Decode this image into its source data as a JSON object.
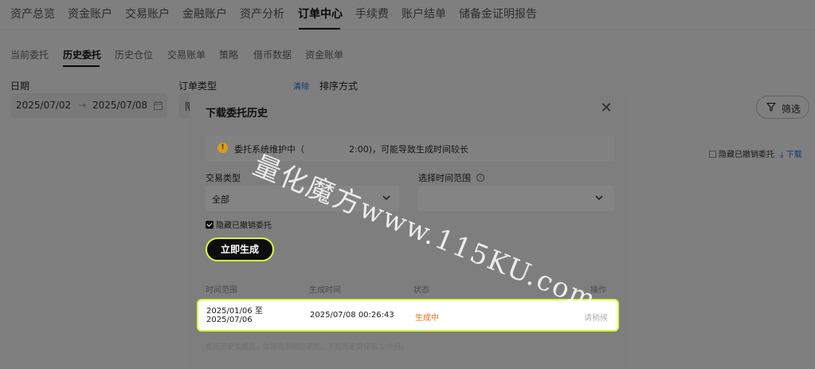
{
  "top_nav": {
    "items": [
      "资产总览",
      "资金账户",
      "交易账户",
      "金融账户",
      "资产分析",
      "订单中心",
      "手续费",
      "账户结单",
      "储备金证明报告"
    ],
    "active_index": 5
  },
  "sub_nav": {
    "items": [
      "当前委托",
      "历史委托",
      "历史仓位",
      "交易账单",
      "策略",
      "借币数据",
      "资金账单"
    ],
    "active_index": 1
  },
  "filters": {
    "date_label": "日期",
    "date_start": "2025/07/02",
    "date_arrow": "→",
    "date_end": "2025/07/08",
    "order_type_label": "订单类型",
    "order_type_value": "限",
    "clear_label": "清除",
    "sort_label": "排序方式",
    "filter_button": "筛选"
  },
  "right_controls": {
    "hide_cancelled": "隐藏已撤销委托",
    "download": "下载"
  },
  "modal": {
    "title": "下载委托历史",
    "close_symbol": "✕",
    "notice": "委托系统维护中（",
    "notice_tail": "2:00)，可能导致生成时间较长",
    "trade_type_label": "交易类型",
    "trade_type_value": "全部",
    "time_range_label": "选择时间范围",
    "hide_cancelled_label": "隐藏已撤销委托",
    "hide_cancelled_checked": true,
    "generate_button": "立即生成",
    "table": {
      "headers": [
        "时间范围",
        "生成时间",
        "状态",
        "操作"
      ],
      "rows": [
        {
          "range_start": "2025/01/06 至",
          "range_end": "2025/07/06",
          "generated_at": "2025/07/08 00:26:43",
          "status": "生成中",
          "action": "请稍候"
        }
      ]
    },
    "footnote": "委托历史生成后，你将收到相应通知。下载历史将保留 1 个月。"
  },
  "watermark": "量化魔方www.115KU.com",
  "colors": {
    "accent_highlight": "#d5ff3f",
    "status_generating": "#e8731c",
    "link_blue": "#1a73e8"
  }
}
